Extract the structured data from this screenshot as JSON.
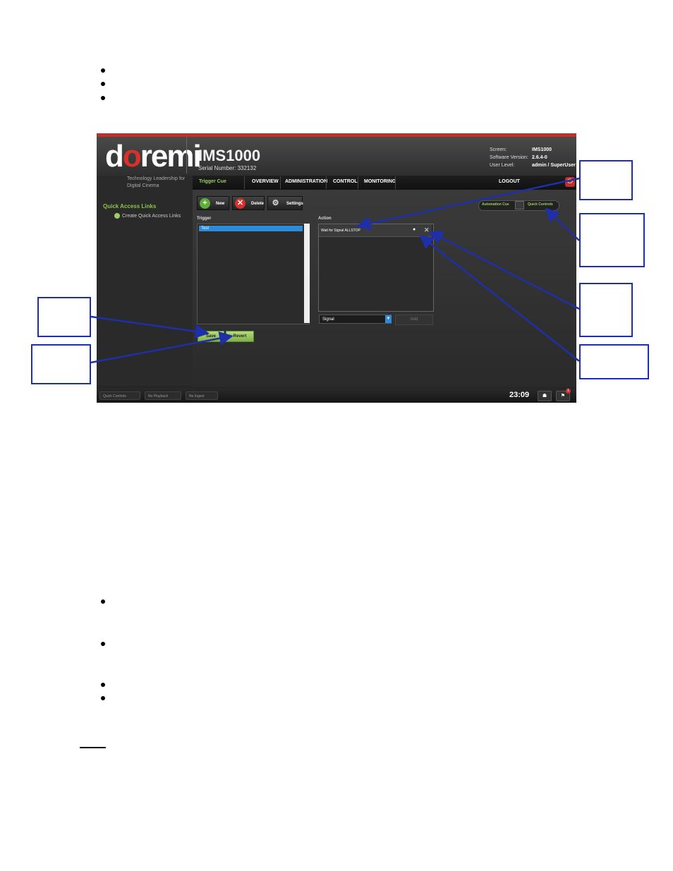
{
  "doc": {
    "top_bullets": 3,
    "bottom_bullets": 4
  },
  "app": {
    "logo_prefix": "d",
    "logo_o": "o",
    "logo_suffix": "remi",
    "tagline": "Technology Leadership for Digital Cinema",
    "model": "IMS1000",
    "serial": "Serial Number: 332132",
    "info": [
      {
        "label": "Screen:",
        "value": "IMS1000"
      },
      {
        "label": "Software Version:",
        "value": "2.6.4-0"
      },
      {
        "label": "User Level:",
        "value": "admin / SuperUser"
      }
    ]
  },
  "nav": {
    "current": "Trigger Cue",
    "items": [
      "OVERVIEW",
      "ADMINISTRATION",
      "CONTROL",
      "MONITORING"
    ],
    "logout": "LOGOUT"
  },
  "sidebar": {
    "title": "Quick Access Links",
    "item": "Create Quick Access Links"
  },
  "toolbar": {
    "new_label": "New",
    "delete_label": "Delete",
    "settings_label": "Settings"
  },
  "trigger": {
    "label": "Trigger",
    "items": [
      "Test"
    ]
  },
  "action": {
    "label": "Action",
    "items": [
      "Wait for Signal ALLSTOP"
    ],
    "select_value": "Signal",
    "add_label": "Add"
  },
  "buttons": {
    "save": "Save",
    "revert": "Revert"
  },
  "mode": {
    "left": "Automation Cue",
    "right": "Quick Controls"
  },
  "status": {
    "quick_controls": "Quick Controls",
    "playback": "No Playback",
    "ingest": "No Ingest",
    "clock": "23:09",
    "flag_count": "1"
  },
  "colors": {
    "accent_green": "#9ccc65",
    "brand_red": "#c0302a",
    "callout_blue": "#1f2fa8",
    "selection_blue": "#2f8ad8"
  }
}
